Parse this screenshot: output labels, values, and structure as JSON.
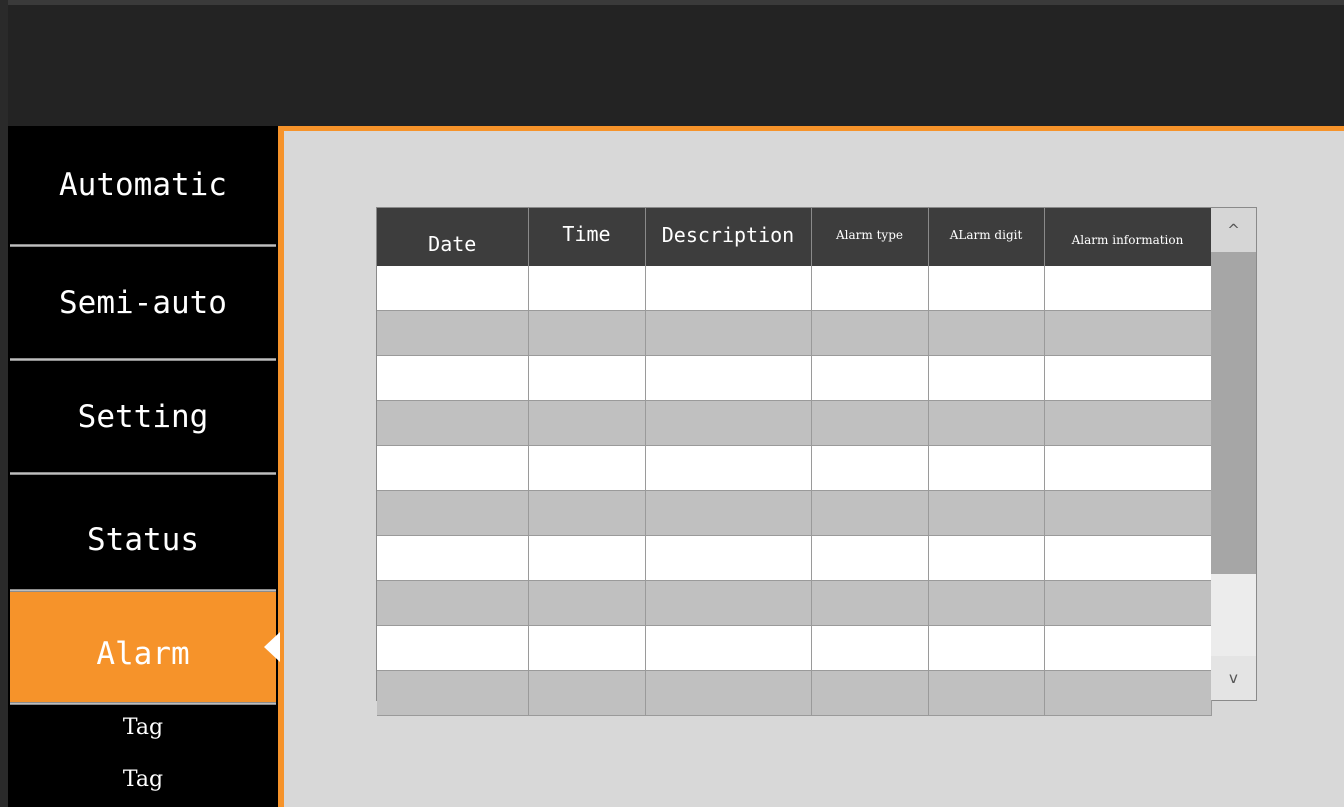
{
  "nav": {
    "items": [
      {
        "label": "Automatic"
      },
      {
        "label": "Semi-auto"
      },
      {
        "label": "Setting"
      },
      {
        "label": "Status"
      },
      {
        "label": "Alarm",
        "active": true
      }
    ],
    "tags": [
      {
        "label": "Tag"
      },
      {
        "label": "Tag"
      }
    ]
  },
  "alarm_table": {
    "columns": [
      {
        "label": "Date"
      },
      {
        "label": "Time"
      },
      {
        "label": "Description"
      },
      {
        "label": "Alarm type"
      },
      {
        "label": "ALarm digit"
      },
      {
        "label": "Alarm information"
      }
    ],
    "rows": [
      [],
      [],
      [],
      [],
      [],
      [],
      [],
      [],
      [],
      []
    ]
  },
  "scrollbar": {
    "up_icon": "chevron-up-icon",
    "down_icon": "chevron-down-icon",
    "up_glyph": "^",
    "down_glyph": "v"
  },
  "colors": {
    "accent": "#f6932a",
    "header_bg": "#3d3d3d",
    "row_alt": "#c0c0c0",
    "sidebar_bg": "#000000"
  }
}
